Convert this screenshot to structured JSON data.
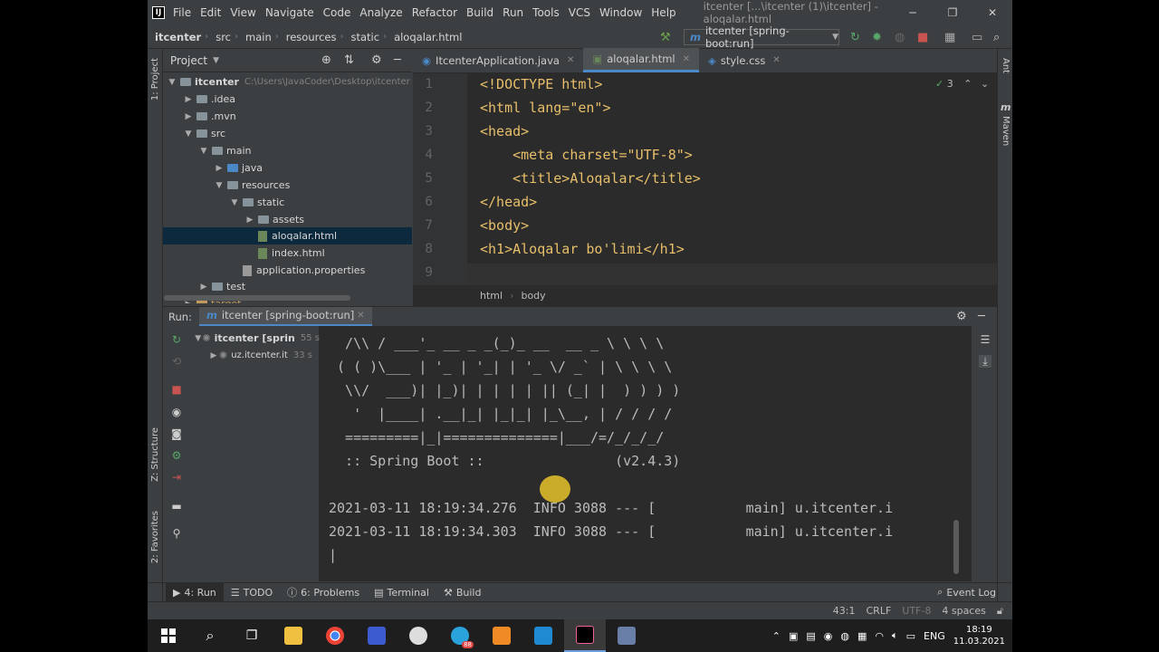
{
  "menu": {
    "items": [
      "File",
      "Edit",
      "View",
      "Navigate",
      "Code",
      "Analyze",
      "Refactor",
      "Build",
      "Run",
      "Tools",
      "VCS",
      "Window",
      "Help"
    ],
    "window_title": "itcenter [...\\itcenter (1)\\itcenter] - aloqalar.html",
    "logo_text": "IJ"
  },
  "navbar": {
    "crumbs": [
      "itcenter",
      "src",
      "main",
      "resources",
      "static",
      "aloqalar.html"
    ],
    "run_config": "itcenter [spring-boot:run]"
  },
  "project": {
    "header": "Project",
    "root": "itcenter",
    "root_path": "C:\\Users\\JavaCoder\\Desktop\\itcenter",
    "items": {
      "idea": ".idea",
      "mvn": ".mvn",
      "src": "src",
      "main": "main",
      "java": "java",
      "resources": "resources",
      "static": "static",
      "assets": "assets",
      "aloqalar": "aloqalar.html",
      "index": "index.html",
      "props": "application.properties",
      "test": "test",
      "target": "target"
    }
  },
  "sidebar_left": {
    "project_label": "1: Project",
    "structure_label": "Z: Structure",
    "favorites_label": "2: Favorites"
  },
  "sidebar_right": {
    "ant_label": "Ant",
    "maven_label": "Maven"
  },
  "editor": {
    "tabs": [
      "ItcenterApplication.java",
      "aloqalar.html",
      "style.css"
    ],
    "active_tab": "aloqalar.html",
    "line_numbers": [
      "1",
      "2",
      "3",
      "4",
      "5",
      "6",
      "7",
      "8",
      "9"
    ],
    "lines": [
      "<!DOCTYPE html>",
      "<html lang=\"en\">",
      "<head>",
      "    <meta charset=\"UTF-8\">",
      "    <title>Aloqalar</title>",
      "</head>",
      "<body>",
      "<h1>Aloqalar bo'limi</h1>",
      ""
    ],
    "inspection_count": "3",
    "breadcrumbs": [
      "html",
      "body"
    ]
  },
  "run": {
    "label": "Run:",
    "tab": "itcenter [spring-boot:run]",
    "tree": [
      {
        "label": "itcenter [sprin",
        "time": "55 s"
      },
      {
        "label": "uz.itcenter.it",
        "time": "33 s"
      }
    ],
    "console": [
      "  /\\\\ / ___'_ __ _ _(_)_ __  __ _ \\ \\ \\ \\",
      " ( ( )\\___ | '_ | '_| | '_ \\/ _` | \\ \\ \\ \\",
      "  \\\\/  ___)| |_)| | | | | || (_| |  ) ) ) )",
      "   '  |____| .__|_| |_|_| |_\\__, | / / / /",
      "  =========|_|==============|___/=/_/_/_/",
      "  :: Spring Boot ::                (v2.4.3)",
      "",
      "2021-03-11 18:19:34.276  INFO 3088 --- [           main] u.itcenter.i",
      "2021-03-11 18:19:34.303  INFO 3088 --- [           main] u.itcenter.i",
      "|"
    ]
  },
  "bottom_tools": [
    "4: Run",
    "TODO",
    "6: Problems",
    "Terminal",
    "Build"
  ],
  "status": {
    "event_log": "Event Log",
    "position": "43:1",
    "line_sep": "CRLF",
    "encoding": "UTF-8",
    "indent": "4 spaces"
  },
  "taskbar": {
    "lang": "ENG",
    "time": "18:19",
    "date": "11.03.2021",
    "badge": "88"
  },
  "colors": {
    "ide_bg": "#3c3f41",
    "editor_bg": "#2b2b2b",
    "tag": "#e8bf6a",
    "string": "#a5c25c",
    "accent": "#4a88c7"
  }
}
